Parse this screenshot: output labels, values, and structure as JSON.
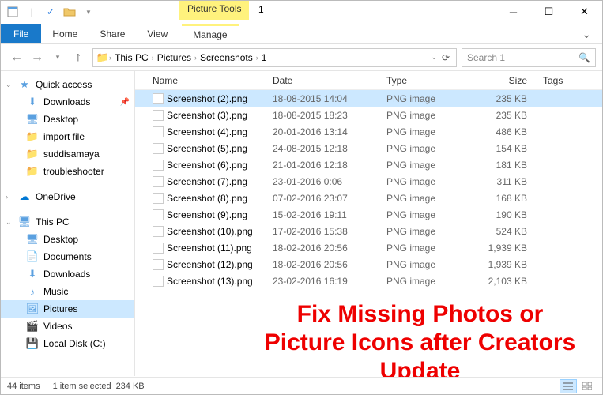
{
  "window": {
    "contextual_tab": "Picture Tools",
    "title": "1"
  },
  "ribbon": {
    "file": "File",
    "home": "Home",
    "share": "Share",
    "view": "View",
    "manage": "Manage"
  },
  "address": {
    "seg0": "This PC",
    "seg1": "Pictures",
    "seg2": "Screenshots",
    "seg3": "1"
  },
  "search": {
    "placeholder": "Search 1"
  },
  "sidebar": {
    "quick_access": "Quick access",
    "downloads": "Downloads",
    "desktop": "Desktop",
    "import_file": "import file",
    "suddisamaya": "suddisamaya",
    "troubleshooter": "troubleshooter",
    "onedrive": "OneDrive",
    "this_pc": "This PC",
    "pc_desktop": "Desktop",
    "documents": "Documents",
    "pc_downloads": "Downloads",
    "music": "Music",
    "pictures": "Pictures",
    "videos": "Videos",
    "local_disk": "Local Disk (C:)"
  },
  "columns": {
    "name": "Name",
    "date": "Date",
    "type": "Type",
    "size": "Size",
    "tags": "Tags"
  },
  "files": [
    {
      "name": "Screenshot (2).png",
      "date": "18-08-2015 14:04",
      "type": "PNG image",
      "size": "235 KB",
      "selected": true
    },
    {
      "name": "Screenshot (3).png",
      "date": "18-08-2015 18:23",
      "type": "PNG image",
      "size": "235 KB"
    },
    {
      "name": "Screenshot (4).png",
      "date": "20-01-2016 13:14",
      "type": "PNG image",
      "size": "486 KB"
    },
    {
      "name": "Screenshot (5).png",
      "date": "24-08-2015 12:18",
      "type": "PNG image",
      "size": "154 KB"
    },
    {
      "name": "Screenshot (6).png",
      "date": "21-01-2016 12:18",
      "type": "PNG image",
      "size": "181 KB"
    },
    {
      "name": "Screenshot (7).png",
      "date": "23-01-2016 0:06",
      "type": "PNG image",
      "size": "311 KB"
    },
    {
      "name": "Screenshot (8).png",
      "date": "07-02-2016 23:07",
      "type": "PNG image",
      "size": "168 KB"
    },
    {
      "name": "Screenshot (9).png",
      "date": "15-02-2016 19:11",
      "type": "PNG image",
      "size": "190 KB"
    },
    {
      "name": "Screenshot (10).png",
      "date": "17-02-2016 15:38",
      "type": "PNG image",
      "size": "524 KB"
    },
    {
      "name": "Screenshot (11).png",
      "date": "18-02-2016 20:56",
      "type": "PNG image",
      "size": "1,939 KB"
    },
    {
      "name": "Screenshot (12).png",
      "date": "18-02-2016 20:56",
      "type": "PNG image",
      "size": "1,939 KB"
    },
    {
      "name": "Screenshot (13).png",
      "date": "23-02-2016 16:19",
      "type": "PNG image",
      "size": "2,103 KB"
    }
  ],
  "overlay": "Fix Missing Photos or Picture Icons after Creators Update",
  "status": {
    "items": "44 items",
    "selected": "1 item selected",
    "sel_size": "234 KB"
  }
}
